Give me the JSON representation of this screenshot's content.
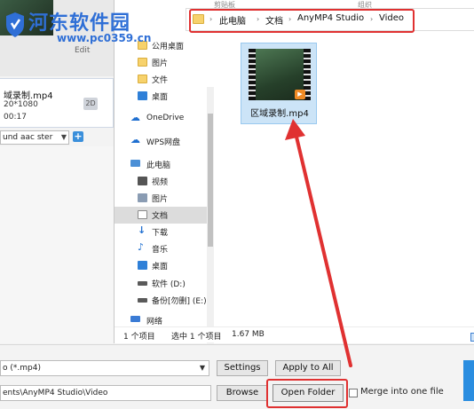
{
  "watermark": {
    "title": "河东软件园",
    "url": "www.pc0359.cn"
  },
  "ribbon_hints": {
    "clipboard": "剪贴板",
    "organize": "组织"
  },
  "background_app": {
    "edit_label": "Edit",
    "file_name": "域录制.mp4",
    "resolution": "20*1080",
    "duration": "00:17",
    "badge": "2D",
    "audio_track": "und aac ster"
  },
  "explorer": {
    "breadcrumb": [
      "此电脑",
      "文档",
      "AnyMP4 Studio",
      "Video"
    ],
    "nav": [
      {
        "label": "公用桌面",
        "icon": "folder-icon"
      },
      {
        "label": "图片",
        "icon": "folder-icon"
      },
      {
        "label": "文件",
        "icon": "folder-icon"
      },
      {
        "label": "桌面",
        "icon": "desktop-icon"
      },
      {
        "label": "OneDrive",
        "icon": "cloud-icon"
      },
      {
        "label": "WPS网盘",
        "icon": "cloud-icon"
      },
      {
        "label": "此电脑",
        "icon": "computer-icon"
      },
      {
        "label": "视频",
        "icon": "video-icon"
      },
      {
        "label": "图片",
        "icon": "picture-icon"
      },
      {
        "label": "文档",
        "icon": "document-icon",
        "selected": true
      },
      {
        "label": "下载",
        "icon": "download-icon"
      },
      {
        "label": "音乐",
        "icon": "music-icon"
      },
      {
        "label": "桌面",
        "icon": "desktop-icon"
      },
      {
        "label": "软件 (D:)",
        "icon": "drive-icon"
      },
      {
        "label": "备份[勿删] (E:)",
        "icon": "drive-icon"
      },
      {
        "label": "网络",
        "icon": "network-icon"
      }
    ],
    "file": {
      "name": "区域录制.mp4"
    },
    "status": {
      "count": "1 个项目",
      "selected": "选中 1 个项目",
      "size": "1.67 MB"
    }
  },
  "bottom": {
    "format": "o (*.mp4)",
    "settings_label": "Settings",
    "apply_label": "Apply to All",
    "path": "ents\\AnyMP4 Studio\\Video",
    "browse_label": "Browse",
    "open_folder_label": "Open Folder",
    "merge_label": "Merge into one file"
  },
  "colors": {
    "highlight": "#e03131",
    "accent": "#2f6fd6"
  }
}
